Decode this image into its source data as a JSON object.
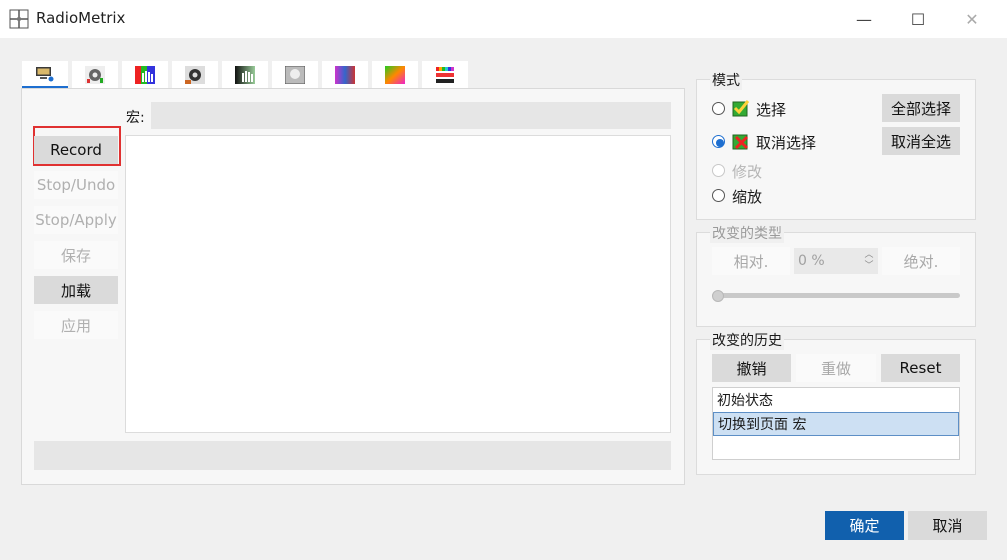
{
  "window": {
    "title": "RadioMetrix",
    "min": "—",
    "max": "☐",
    "close": "✕"
  },
  "tabs": [
    {
      "icon": "monitor-icon"
    },
    {
      "icon": "gear-chart-icon"
    },
    {
      "icon": "hand-rgb-icon"
    },
    {
      "icon": "gear-dark-icon"
    },
    {
      "icon": "hand-gradient-icon"
    },
    {
      "icon": "gray-image-icon"
    },
    {
      "icon": "color-bars-icon"
    },
    {
      "icon": "color-square-icon"
    },
    {
      "icon": "palette-icon"
    }
  ],
  "macro": {
    "label": "宏:",
    "buttons": {
      "record": "Record",
      "stop_undo": "Stop/Undo",
      "stop_apply": "Stop/Apply",
      "save": "保存",
      "load": "加载",
      "apply": "应用"
    }
  },
  "mode": {
    "title": "模式",
    "options": [
      {
        "label": "选择",
        "checked": false,
        "enabled": true
      },
      {
        "label": "取消选择",
        "checked": true,
        "enabled": true
      },
      {
        "label": "修改",
        "checked": false,
        "enabled": false
      },
      {
        "label": "缩放",
        "checked": false,
        "enabled": true
      }
    ],
    "select_all": "全部选择",
    "deselect_all": "取消全选"
  },
  "change_type": {
    "title": "改变的类型",
    "relative": "相对.",
    "percent": "0 %",
    "absolute": "绝对."
  },
  "history": {
    "title": "改变的历史",
    "undo": "撤销",
    "redo": "重做",
    "reset": "Reset",
    "items": [
      "初始状态",
      "切换到页面 宏"
    ],
    "selected_index": 1
  },
  "dialog": {
    "ok": "确定",
    "cancel": "取消"
  },
  "colors": {
    "accent": "#1160ad",
    "highlight": "#e03131",
    "selection": "#cde0f3"
  }
}
